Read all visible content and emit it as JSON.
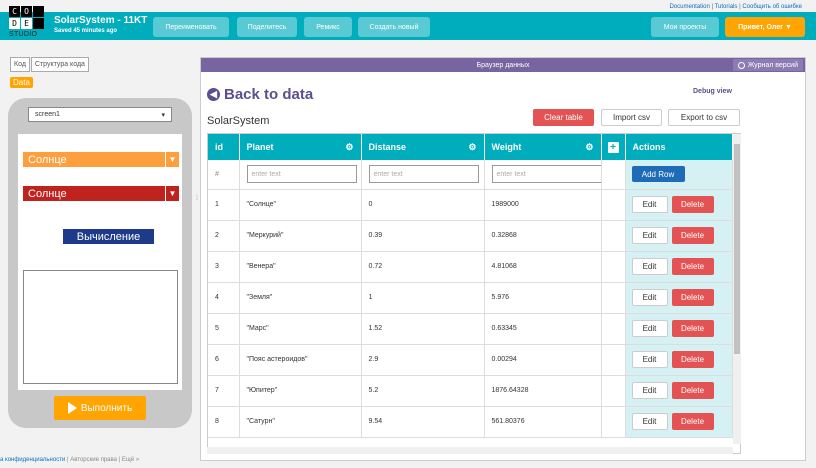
{
  "top_links": {
    "documentation": "Documentation",
    "tutorials": "Tutorials",
    "report": "Сообщить об ошибке"
  },
  "header": {
    "logo_letters": [
      "C",
      "O",
      "",
      "D",
      "E",
      ""
    ],
    "logo_studio": "STUDIO",
    "project_title": "SolarSystem - 11KT",
    "saved_text": "Saved 45 minutes ago",
    "rename": "Переименовать",
    "share": "Поделитесь",
    "remix": "Ремикс",
    "create_new": "Создать новый",
    "my_projects": "Мои проекты",
    "user_greeting": "Привет, Олег ▼"
  },
  "left": {
    "tab_code": "Код",
    "tab_structure": "Структура кода",
    "data_tag": "Data",
    "screen_select": "screen1",
    "dropdown1": "Солнце",
    "dropdown2": "Солнце",
    "calc_button": "Вычисление",
    "run_button": "Выполнить"
  },
  "footer": {
    "privacy": "а конфиденциальности",
    "sep1": "|",
    "copyright": "Авторские права",
    "sep2": "|",
    "more": "Ещё »"
  },
  "panel": {
    "title": "Браузер данных",
    "version_button": "Журнал версий",
    "back": "Back to data",
    "debug": "Debug view",
    "table_name": "SolarSystem",
    "clear": "Clear table",
    "import": "Import csv",
    "export": "Export to csv"
  },
  "table": {
    "headers": {
      "id": "id",
      "planet": "Planet",
      "distanse": "Distanse",
      "weight": "Weight",
      "actions": "Actions"
    },
    "input_hash": "#",
    "placeholder": "enter text",
    "add_row": "Add Row",
    "edit": "Edit",
    "delete": "Delete",
    "rows": [
      {
        "id": "1",
        "planet": "\"Солнце\"",
        "distanse": "0",
        "weight": "1989000"
      },
      {
        "id": "2",
        "planet": "\"Меркурий\"",
        "distanse": "0.39",
        "weight": "0.32868"
      },
      {
        "id": "3",
        "planet": "\"Венера\"",
        "distanse": "0.72",
        "weight": "4.81068"
      },
      {
        "id": "4",
        "planet": "\"Земля\"",
        "distanse": "1",
        "weight": "5.976"
      },
      {
        "id": "5",
        "planet": "\"Марс\"",
        "distanse": "1.52",
        "weight": "0.63345"
      },
      {
        "id": "6",
        "planet": "\"Пояс астероидов\"",
        "distanse": "2.9",
        "weight": "0.00294"
      },
      {
        "id": "7",
        "planet": "\"Юпитер\"",
        "distanse": "5.2",
        "weight": "1876.64328"
      },
      {
        "id": "8",
        "planet": "\"Сатурн\"",
        "distanse": "9.54",
        "weight": "561.80376"
      }
    ]
  },
  "colors": {
    "teal": "#00adbc",
    "orange": "#ffa400",
    "purple": "#7665a0",
    "red": "#e35353",
    "dropdown1": "#ff9e3d",
    "dropdown2": "#c0231e"
  }
}
